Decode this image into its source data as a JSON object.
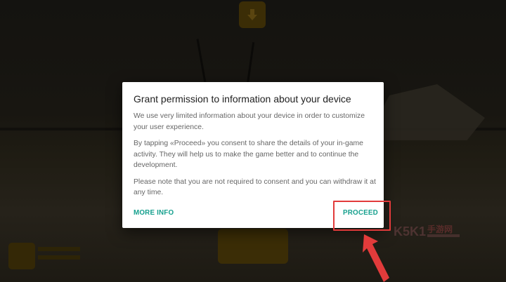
{
  "dialog": {
    "title": "Grant permission to information about your device",
    "paragraphs": [
      "We use very limited information about your device in order to customize your user experience.",
      "By tapping «Proceed» you consent to share the details of your in-game activity. They will help us to make the game better and to continue the development.",
      "Please note that you are not required to consent and you can withdraw it at any time."
    ],
    "more_info_label": "MORE INFO",
    "proceed_label": "PROCEED"
  },
  "background": {
    "top_icon": "download-icon"
  },
  "colors": {
    "accent": "#16a08e",
    "annotation": "#e23b3b",
    "dialog_bg": "#ffffff",
    "title_text": "#212121",
    "body_text": "#666666"
  },
  "watermark": {
    "logo_text": "K5K1手游网"
  }
}
